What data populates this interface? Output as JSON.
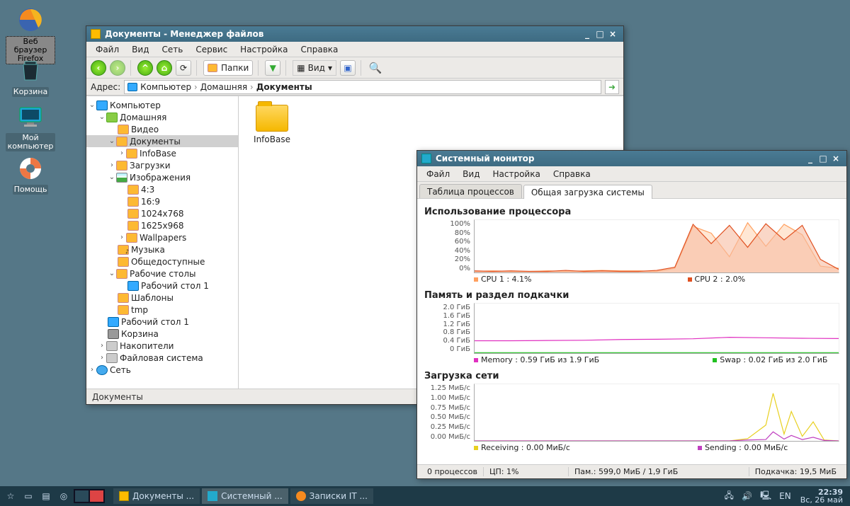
{
  "desktop_icons": {
    "firefox": "Веб браузер Firefox",
    "trash": "Корзина",
    "computer": "Мой компьютер",
    "help": "Помощь"
  },
  "fm": {
    "title": "Документы - Менеджер файлов",
    "menu": {
      "file": "Файл",
      "view": "Вид",
      "net": "Сеть",
      "tools": "Сервис",
      "settings": "Настройка",
      "help": "Справка"
    },
    "toolbar": {
      "folders": "Папки",
      "view": "Вид"
    },
    "addr_label": "Адрес:",
    "crumbs": {
      "computer": "Компьютер",
      "home": "Домашняя",
      "docs": "Документы"
    },
    "tree": {
      "computer": "Компьютер",
      "home": "Домашняя",
      "video": "Видео",
      "documents": "Документы",
      "infobase": "InfoBase",
      "downloads": "Загрузки",
      "images": "Изображения",
      "r43": "4:3",
      "r169": "16:9",
      "r1024": "1024x768",
      "r1625": "1625x968",
      "wallpapers": "Wallpapers",
      "music": "Музыка",
      "public": "Общедоступные",
      "desktops": "Рабочие столы",
      "desktop1": "Рабочий стол 1",
      "templates": "Шаблоны",
      "tmp": "tmp",
      "desk1": "Рабочий стол 1",
      "trash": "Корзина",
      "drives": "Накопители",
      "filesystem": "Файловая система",
      "network": "Сеть"
    },
    "file_item": "InfoBase",
    "status": "Документы"
  },
  "mon": {
    "title": "Системный монитор",
    "menu": {
      "file": "Файл",
      "view": "Вид",
      "settings": "Настройка",
      "help": "Справка"
    },
    "tabs": {
      "procs": "Таблица процессов",
      "load": "Общая загрузка системы"
    },
    "sections": {
      "cpu": "Использование процессора",
      "mem": "Память и раздел подкачки",
      "net": "Загрузка сети"
    },
    "cpu_legend": {
      "c1": "CPU 1 : 4.1%",
      "c2": "CPU 2 : 2.0%"
    },
    "mem_legend": {
      "m": "Memory : 0.59 ГиБ из 1.9 ГиБ",
      "s": "Swap : 0.02 ГиБ из 2.0 ГиБ"
    },
    "net_legend": {
      "r": "Receiving : 0.00 МиБ/с",
      "s": "Sending : 0.00 МиБ/с"
    },
    "status": {
      "procs": "0 процессов",
      "cpu": "ЦП: 1%",
      "mem": "Пам.: 599,0 МиБ / 1,9 ГиБ",
      "swap": "Подкачка: 19,5 МиБ"
    }
  },
  "taskbar": {
    "tasks": {
      "fm": "Документы ...",
      "mon": "Системный ...",
      "ff": "Записки IT ..."
    },
    "lang": "EN",
    "time": "22:39",
    "date": "Вс, 26 май"
  },
  "chart_data": [
    {
      "type": "line",
      "title": "Использование процессора",
      "ylabel": "%",
      "ylim": [
        0,
        100
      ],
      "y_ticks": [
        "100%",
        "80%",
        "60%",
        "40%",
        "20%",
        "0%"
      ],
      "x": [
        0,
        5,
        10,
        15,
        20,
        25,
        30,
        35,
        40,
        45,
        50,
        55,
        60,
        65,
        70,
        75,
        80,
        85,
        90,
        95,
        100
      ],
      "series": [
        {
          "name": "CPU 1",
          "color": "#ffa060",
          "fill": "#ffd7b8",
          "values": [
            2,
            3,
            2,
            2,
            3,
            2,
            3,
            4,
            3,
            3,
            2,
            8,
            88,
            75,
            30,
            95,
            50,
            92,
            72,
            12,
            8
          ]
        },
        {
          "name": "CPU 2",
          "color": "#e05020",
          "fill": "#f7bda2",
          "values": [
            3,
            2,
            3,
            2,
            2,
            4,
            2,
            3,
            2,
            2,
            4,
            10,
            92,
            55,
            90,
            48,
            93,
            62,
            90,
            25,
            6
          ]
        }
      ]
    },
    {
      "type": "line",
      "title": "Память и раздел подкачки",
      "ylabel": "ГиБ",
      "ylim": [
        0,
        2.0
      ],
      "y_ticks": [
        "2.0 ГиБ",
        "1.6 ГиБ",
        "1.2 ГиБ",
        "0.8 ГиБ",
        "0.4 ГиБ",
        "0 ГиБ"
      ],
      "x": [
        0,
        10,
        20,
        30,
        40,
        50,
        60,
        70,
        80,
        90,
        100
      ],
      "series": [
        {
          "name": "Memory",
          "color": "#e030c0",
          "values": [
            0.5,
            0.5,
            0.51,
            0.52,
            0.55,
            0.56,
            0.58,
            0.64,
            0.62,
            0.6,
            0.59
          ]
        },
        {
          "name": "Swap",
          "color": "#20c020",
          "values": [
            0.02,
            0.02,
            0.02,
            0.02,
            0.02,
            0.02,
            0.02,
            0.02,
            0.02,
            0.02,
            0.02
          ]
        }
      ]
    },
    {
      "type": "line",
      "title": "Загрузка сети",
      "ylabel": "МиБ/с",
      "ylim": [
        0,
        1.25
      ],
      "y_ticks": [
        "1.25 МиБ/с",
        "1.00 МиБ/с",
        "0.75 МиБ/с",
        "0.50 МиБ/с",
        "0.25 МиБ/с",
        "0.00 МиБ/с"
      ],
      "x": [
        0,
        10,
        20,
        30,
        40,
        50,
        60,
        70,
        75,
        80,
        82,
        85,
        87,
        90,
        93,
        96,
        100
      ],
      "series": [
        {
          "name": "Receiving",
          "color": "#e8d020",
          "values": [
            0,
            0,
            0,
            0,
            0,
            0,
            0,
            0,
            0.05,
            0.35,
            1.05,
            0.15,
            0.65,
            0.1,
            0.42,
            0.02,
            0.0
          ]
        },
        {
          "name": "Sending",
          "color": "#c040c0",
          "values": [
            0,
            0,
            0,
            0,
            0,
            0,
            0,
            0,
            0.02,
            0.03,
            0.2,
            0.04,
            0.12,
            0.03,
            0.08,
            0.01,
            0.0
          ]
        }
      ]
    }
  ]
}
